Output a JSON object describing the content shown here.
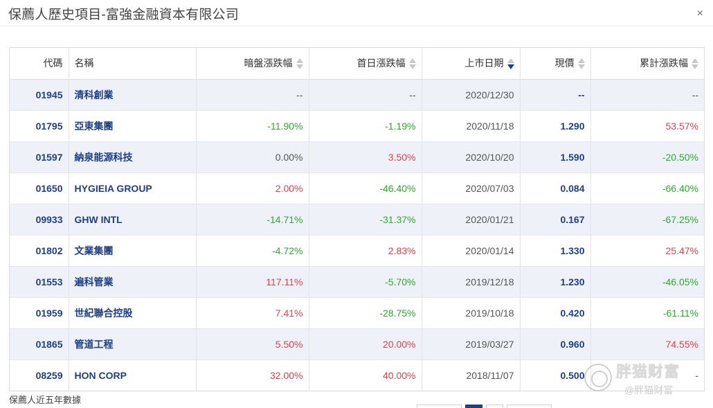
{
  "dialog": {
    "title": "保薦人歷史項目-富強金融資本有限公司",
    "close_glyph": "×"
  },
  "table": {
    "headers": {
      "code": "代碼",
      "name": "名稱",
      "grey_market": "暗盤漲跌幅",
      "first_day": "首日漲跌幅",
      "listing_date": "上市日期",
      "price": "現價",
      "cumulative": "累計漲跌幅"
    },
    "sorted_by": "listing_date",
    "sort_direction": "desc",
    "rows": [
      {
        "code": "01945",
        "name": "清科創業",
        "grey": "--",
        "grey_dir": "flat",
        "first": "--",
        "first_dir": "flat",
        "date": "2020/12/30",
        "price": "--",
        "cum": "--",
        "cum_dir": "flat"
      },
      {
        "code": "01795",
        "name": "亞東集團",
        "grey": "-11.90%",
        "grey_dir": "down",
        "first": "-1.19%",
        "first_dir": "down",
        "date": "2020/11/18",
        "price": "1.290",
        "cum": "53.57%",
        "cum_dir": "up"
      },
      {
        "code": "01597",
        "name": "納泉能源科技",
        "grey": "0.00%",
        "grey_dir": "flat",
        "first": "3.50%",
        "first_dir": "up",
        "date": "2020/10/20",
        "price": "1.590",
        "cum": "-20.50%",
        "cum_dir": "down"
      },
      {
        "code": "01650",
        "name": "HYGIEIA GROUP",
        "grey": "2.00%",
        "grey_dir": "up",
        "first": "-46.40%",
        "first_dir": "down",
        "date": "2020/07/03",
        "price": "0.084",
        "cum": "-66.40%",
        "cum_dir": "down"
      },
      {
        "code": "09933",
        "name": "GHW INTL",
        "grey": "-14.71%",
        "grey_dir": "down",
        "first": "-31.37%",
        "first_dir": "down",
        "date": "2020/01/21",
        "price": "0.167",
        "cum": "-67.25%",
        "cum_dir": "down"
      },
      {
        "code": "01802",
        "name": "文業集團",
        "grey": "-4.72%",
        "grey_dir": "down",
        "first": "2.83%",
        "first_dir": "up",
        "date": "2020/01/14",
        "price": "1.330",
        "cum": "25.47%",
        "cum_dir": "up"
      },
      {
        "code": "01553",
        "name": "遍科管業",
        "grey": "117.11%",
        "grey_dir": "up",
        "first": "-5.70%",
        "first_dir": "down",
        "date": "2019/12/18",
        "price": "1.230",
        "cum": "-46.05%",
        "cum_dir": "down"
      },
      {
        "code": "01959",
        "name": "世紀聯合控股",
        "grey": "7.41%",
        "grey_dir": "up",
        "first": "-28.75%",
        "first_dir": "down",
        "date": "2019/10/18",
        "price": "0.420",
        "cum": "-61.11%",
        "cum_dir": "down"
      },
      {
        "code": "01865",
        "name": "管道工程",
        "grey": "5.50%",
        "grey_dir": "up",
        "first": "20.00%",
        "first_dir": "up",
        "date": "2019/03/27",
        "price": "0.960",
        "cum": "74.55%",
        "cum_dir": "up"
      },
      {
        "code": "08259",
        "name": "HON CORP",
        "grey": "32.00%",
        "grey_dir": "up",
        "first": "40.00%",
        "first_dir": "up",
        "date": "2018/11/07",
        "price": "0.500",
        "cum": "-",
        "cum_dir": "flat"
      }
    ]
  },
  "footnote": "保薦人近五年數據",
  "watermark": {
    "main": "胖猫财富",
    "sub": "@胖猫财富"
  },
  "colors": {
    "up": "#e0424f",
    "down": "#2eaa2e",
    "link": "#1f3f84",
    "stripe": "#eef2f8"
  }
}
